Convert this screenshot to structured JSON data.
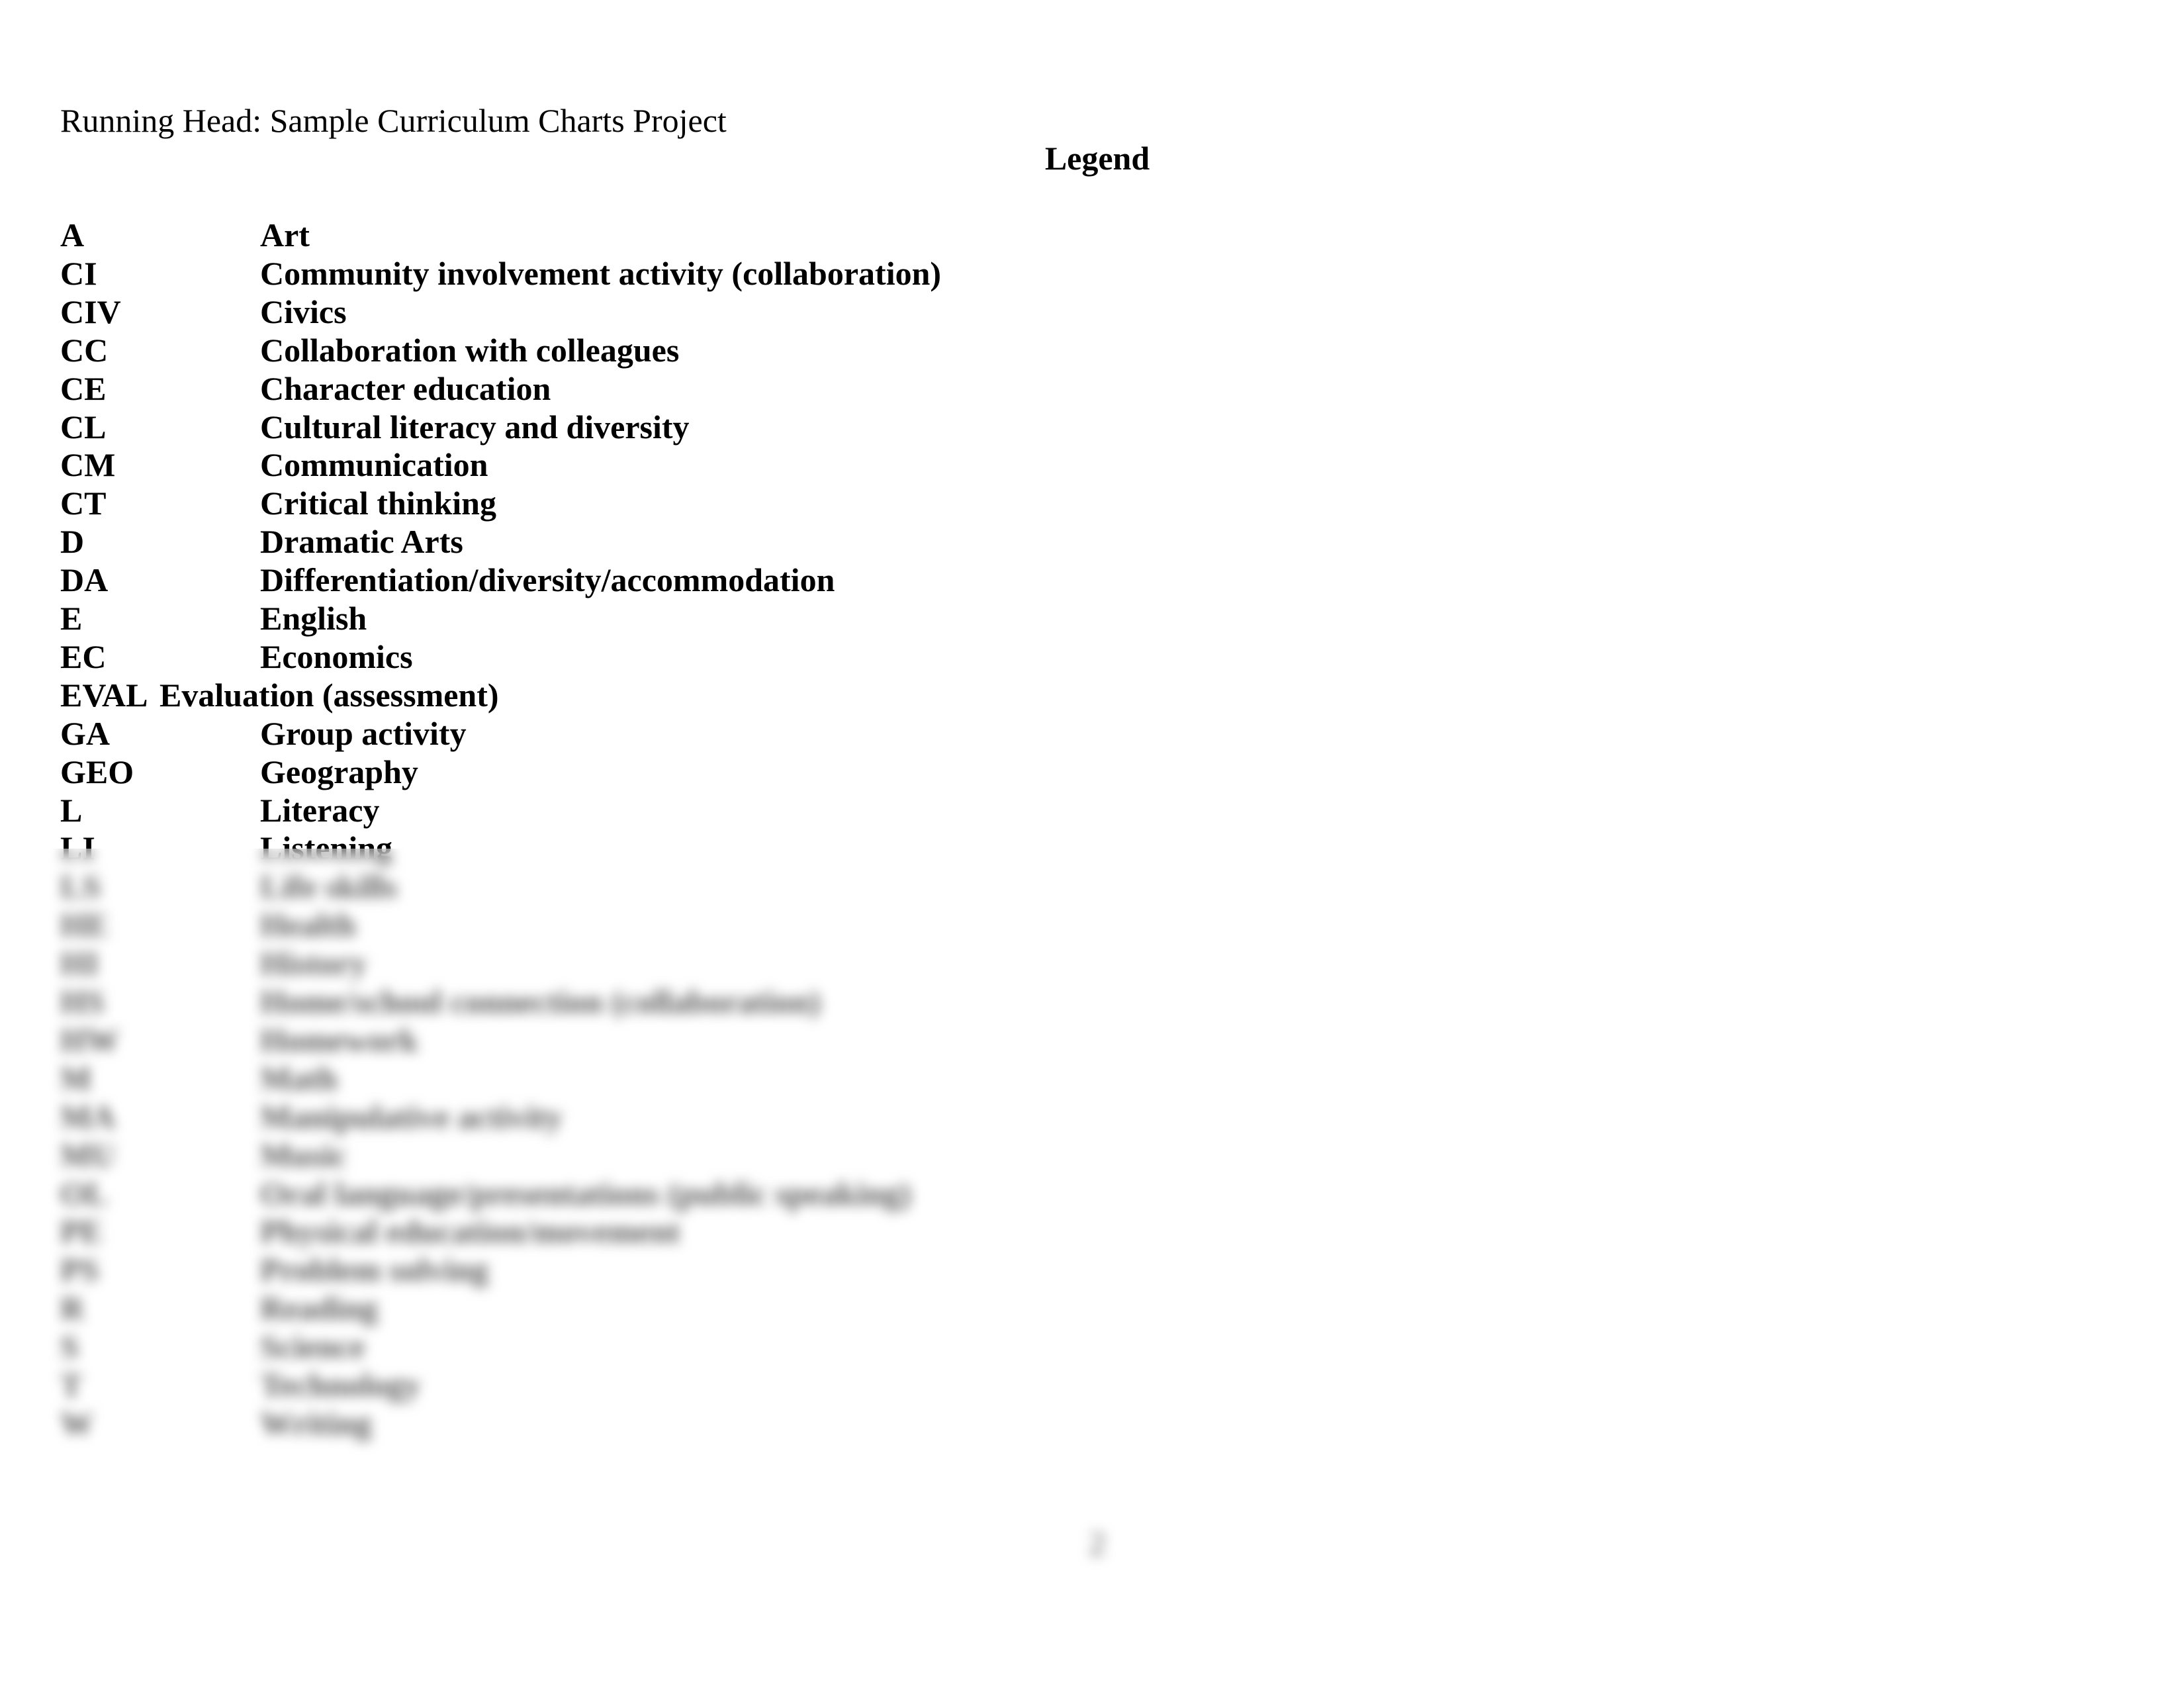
{
  "running_head": "Running Head: Sample Curriculum Charts Project",
  "legend_title": "Legend",
  "legend": [
    {
      "abbr": "A",
      "term": "Art"
    },
    {
      "abbr": "CI",
      "term": "Community involvement activity (collaboration)"
    },
    {
      "abbr": "CIV",
      "term": "Civics"
    },
    {
      "abbr": "CC",
      "term": "Collaboration with colleagues"
    },
    {
      "abbr": "CE",
      "term": "Character education"
    },
    {
      "abbr": "CL",
      "term": "Cultural literacy and diversity"
    },
    {
      "abbr": "CM",
      "term": "Communication"
    },
    {
      "abbr": "CT",
      "term": "Critical thinking"
    },
    {
      "abbr": "D",
      "term": "Dramatic Arts"
    },
    {
      "abbr": "DA",
      "term": "Differentiation/diversity/accommodation"
    },
    {
      "abbr": "E",
      "term": "English"
    },
    {
      "abbr": "EC",
      "term": "Economics"
    },
    {
      "abbr": "EVAL",
      "term": "Evaluation (assessment)"
    },
    {
      "abbr": "GA",
      "term": "Group activity"
    },
    {
      "abbr": "GEO",
      "term": "Geography"
    },
    {
      "abbr": "L",
      "term": "Literacy"
    },
    {
      "abbr": "LI",
      "term": "Listening"
    },
    {
      "abbr": "LS",
      "term": "Life skills"
    },
    {
      "abbr": "HE",
      "term": "Health"
    },
    {
      "abbr": "HI",
      "term": "History"
    },
    {
      "abbr": "HS",
      "term": "Home/school connection (collaboration)"
    },
    {
      "abbr": "HW",
      "term": "Homework"
    },
    {
      "abbr": "M",
      "term": "Math"
    },
    {
      "abbr": "MA",
      "term": "Manipulative activity"
    },
    {
      "abbr": "MU",
      "term": "Music"
    },
    {
      "abbr": "OL",
      "term": "Oral language/presentations (public speaking)"
    },
    {
      "abbr": "PE",
      "term": "Physical education/movement"
    },
    {
      "abbr": "PS",
      "term": "Problem solving"
    },
    {
      "abbr": "R",
      "term": "Reading"
    },
    {
      "abbr": "S",
      "term": "Science"
    },
    {
      "abbr": "T",
      "term": "Technology"
    },
    {
      "abbr": "W",
      "term": "Writing"
    }
  ],
  "page_number": "2"
}
